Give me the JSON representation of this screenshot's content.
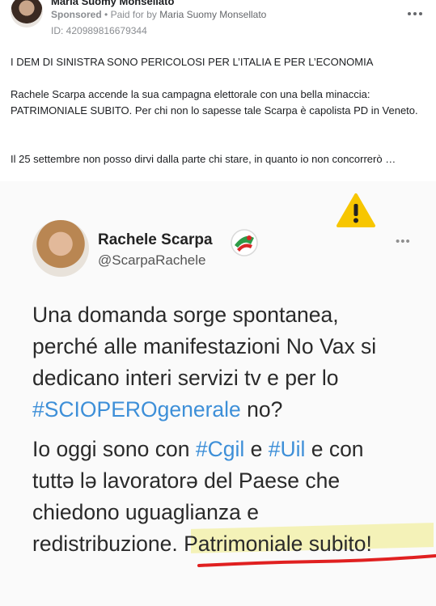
{
  "post": {
    "advertiser_name": "Maria Suomy Monsellato",
    "sponsored_label": "Sponsored",
    "separator": "•",
    "paid_for_label": "Paid for by",
    "payer_name": "Maria Suomy Monsellato",
    "ad_id": "ID: 420989816679344",
    "paragraph1": "I DEM DI SINISTRA SONO PERICOLOSI PER L’ITALIA E PER L’ECONOMIA",
    "paragraph2": "Rachele Scarpa accende la sua campagna elettorale con una bella minaccia: PATRIMONIALE SUBITO. Per chi non lo sapesse tale Scarpa è capolista PD in Veneto.",
    "paragraph3": "Il 25 settembre non posso dirvi dalla parte chi stare, in quanto io non concorrerò …"
  },
  "tweet": {
    "name": "Rachele Scarpa",
    "handle": "@ScarpaRachele",
    "more": "•••",
    "line1": "Una domanda sorge spontanea,",
    "line2": "perché alle manifestazioni No Vax si",
    "line3": "dedicano interi servizi tv e per lo",
    "line4_tag": "#SCIOPEROgenerale",
    "line4_rest": " no?",
    "line5_pre": "Io oggi sono con ",
    "line5_tag1": "#Cgil",
    "line5_mid": " e ",
    "line5_tag2": "#Uil",
    "line5_post": " e con",
    "line6": "tuttə lə lavoratorə del Paese che",
    "line7": "chiedono uguaglianza e",
    "line8_pre": "redistribuzione. ",
    "line8_highlight": "Patrimoniale subito!"
  },
  "colors": {
    "hashtag": "#3d8fd8",
    "highlight": "#f2f0a8",
    "underline": "#e02020",
    "warning": "#f7c600"
  },
  "icons": {
    "warning": "warning-icon",
    "menu": "more-options-icon",
    "party_logo": "pd-logo-icon"
  }
}
